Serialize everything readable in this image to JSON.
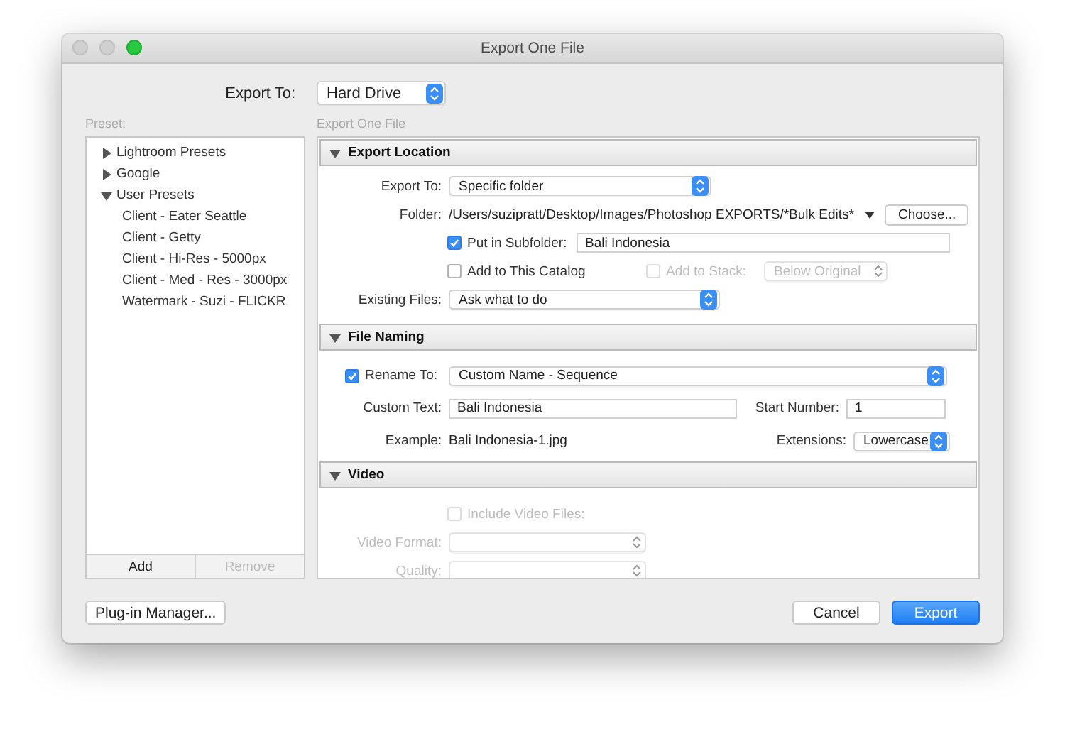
{
  "window": {
    "title": "Export One File"
  },
  "export_to": {
    "label": "Export To:",
    "value": "Hard Drive"
  },
  "preset": {
    "label": "Preset:",
    "tree": [
      {
        "label": "Lightroom Presets",
        "expanded": false
      },
      {
        "label": "Google",
        "expanded": false
      },
      {
        "label": "User Presets",
        "expanded": true,
        "children": [
          {
            "label": "Client - Eater Seattle"
          },
          {
            "label": "Client - Getty"
          },
          {
            "label": "Client - Hi-Res - 5000px"
          },
          {
            "label": "Client - Med - Res - 3000px"
          },
          {
            "label": "Watermark - Suzi - FLICKR"
          }
        ]
      }
    ],
    "buttons": [
      {
        "label": "Add",
        "disabled": false
      },
      {
        "label": "Remove",
        "disabled": true
      }
    ]
  },
  "settings": {
    "heading": "Export One File",
    "sections": [
      {
        "kind": "location",
        "title": "Export Location",
        "expanded": true,
        "export_to": {
          "label": "Export To:",
          "value": "Specific folder"
        },
        "folder": {
          "label": "Folder:",
          "path": "/Users/suzipratt/Desktop/Images/Photoshop EXPORTS/*Bulk Edits*",
          "button": "Choose..."
        },
        "subfolder": {
          "label": "Put in Subfolder:",
          "checked": true,
          "value": "Bali Indonesia"
        },
        "catalog": {
          "label": "Add to This Catalog",
          "checked": false
        },
        "stack": {
          "label": "Add to Stack:",
          "checked": false,
          "disabled": true,
          "value": "Below Original"
        },
        "existing": {
          "label": "Existing Files:",
          "value": "Ask what to do"
        }
      },
      {
        "kind": "naming",
        "title": "File Naming",
        "expanded": true,
        "rename": {
          "label": "Rename To:",
          "checked": true,
          "value": "Custom Name - Sequence"
        },
        "custom_text": {
          "label": "Custom Text:",
          "value": "Bali Indonesia"
        },
        "start_number": {
          "label": "Start Number:",
          "value": "1"
        },
        "example": {
          "label": "Example:",
          "value": "Bali Indonesia-1.jpg"
        },
        "extensions": {
          "label": "Extensions:",
          "value": "Lowercase"
        }
      },
      {
        "kind": "video",
        "title": "Video",
        "expanded": true,
        "include": {
          "label": "Include Video Files:",
          "checked": false,
          "disabled": true
        },
        "format": {
          "label": "Video Format:",
          "disabled": true
        },
        "quality": {
          "label": "Quality:",
          "disabled": true
        }
      }
    ]
  },
  "plugin_button": {
    "label": "Plug-in Manager..."
  },
  "dialog_buttons": [
    {
      "label": "Cancel",
      "default": false
    },
    {
      "label": "Export",
      "default": true
    }
  ]
}
